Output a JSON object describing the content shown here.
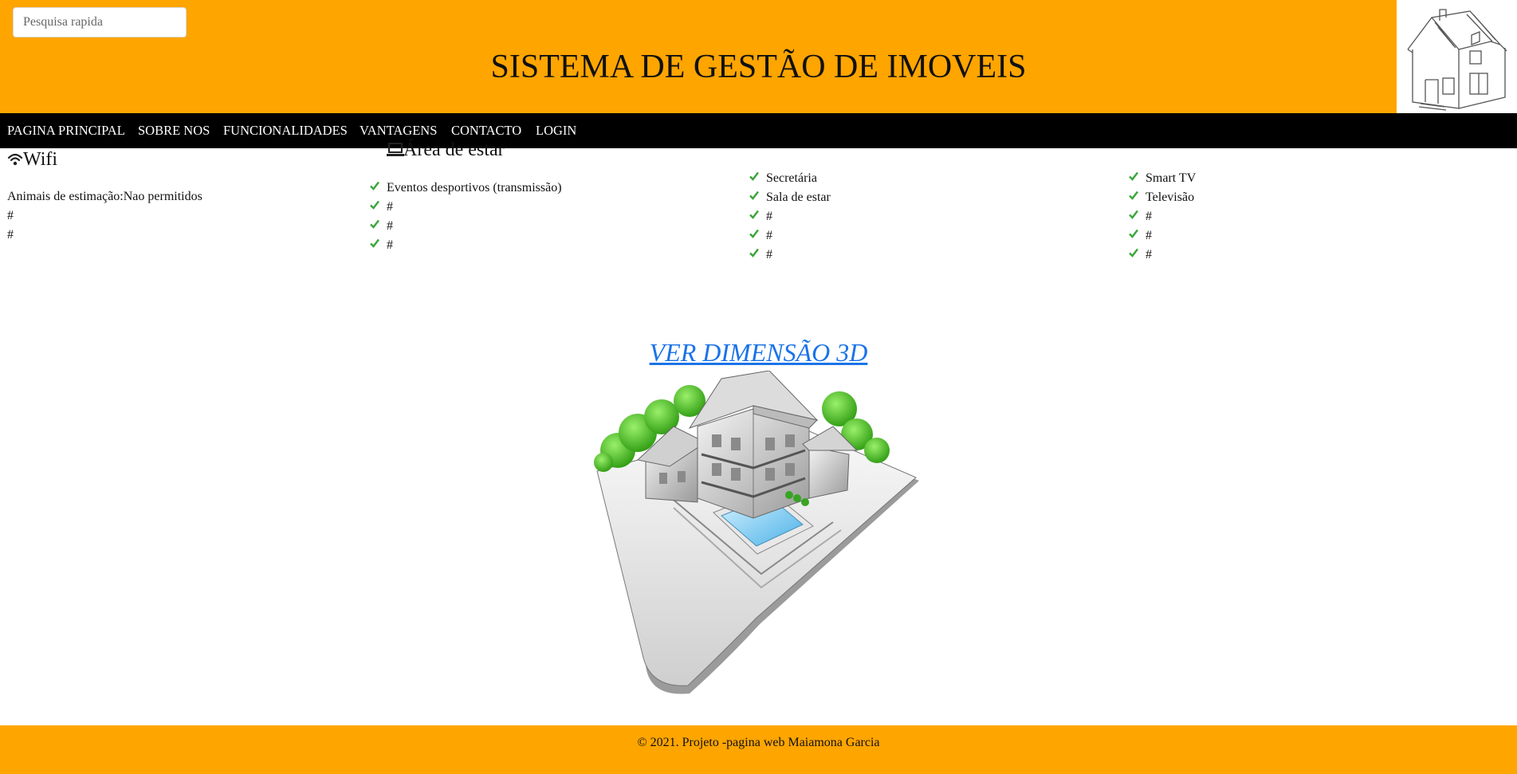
{
  "search": {
    "placeholder": "Pesquisa rapida"
  },
  "header": {
    "title": "SISTEMA DE GESTÃO DE IMOVEIS",
    "logo_icon": "house-sketch-icon"
  },
  "nav": {
    "items": [
      {
        "label": "PAGINA PRINCIPAL"
      },
      {
        "label": "SOBRE NOS"
      },
      {
        "label": "FUNCIONALIDADES"
      },
      {
        "label": "VANTAGENS"
      },
      {
        "label": "CONTACTO"
      },
      {
        "label": "LOGIN"
      }
    ]
  },
  "features": {
    "col1": {
      "title": "Wifi",
      "icon": "wifi-icon",
      "items": [
        "Animais de estimação:Nao permitidos",
        "#",
        "#"
      ]
    },
    "col2": {
      "title": "Área de estar",
      "icon": "laptop-icon",
      "items": [
        "Eventos desportivos (transmissão)",
        "#",
        "#",
        "#"
      ]
    },
    "col3": {
      "items": [
        "Secretária",
        "Sala de estar",
        "#",
        "#",
        "#"
      ]
    },
    "col4": {
      "items": [
        "Smart TV",
        "Televisão",
        "#",
        "#",
        "#"
      ]
    },
    "check_color": "#3aa53a"
  },
  "main": {
    "link_3d": "VER DIMENSÃO 3D"
  },
  "footer": {
    "text": "© 2021. Projeto -pagina web Maiamona Garcia"
  },
  "colors": {
    "brand": "#FFA500",
    "nav_bg": "#000000",
    "link": "#1a73e8"
  }
}
